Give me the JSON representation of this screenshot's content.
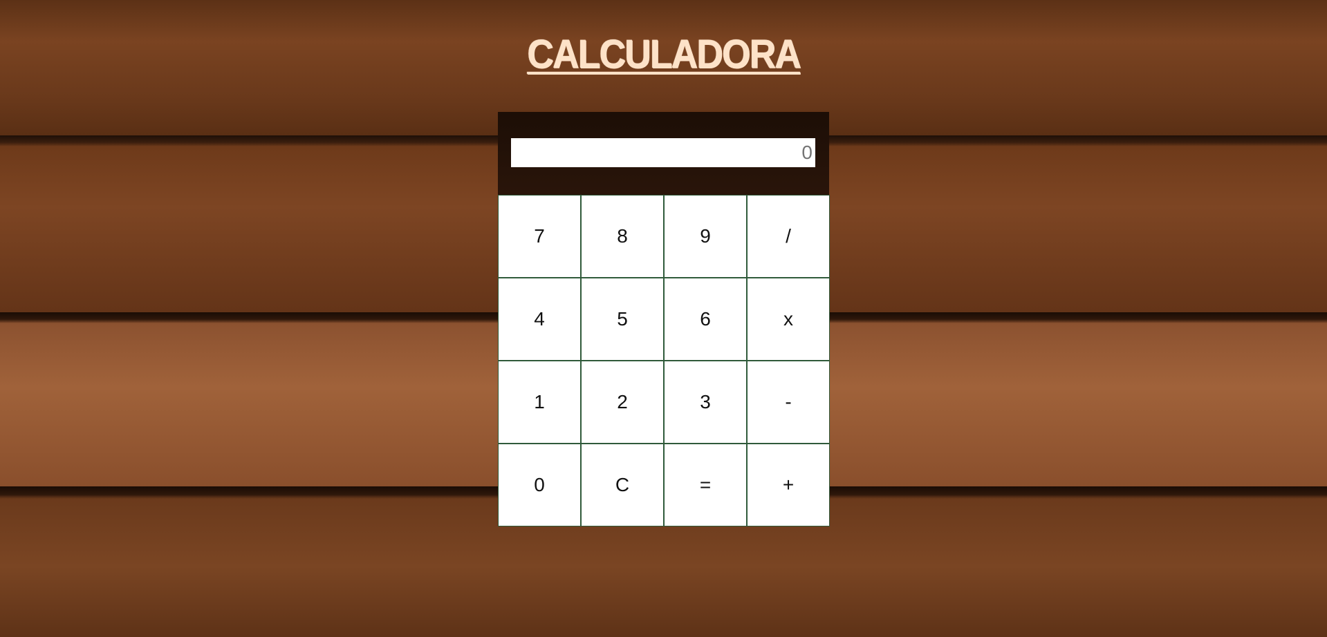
{
  "page": {
    "title": "CALCULADORA"
  },
  "display": {
    "placeholder": "0",
    "value": ""
  },
  "keys": {
    "seven": "7",
    "eight": "8",
    "nine": "9",
    "divide": "/",
    "four": "4",
    "five": "5",
    "six": "6",
    "multiply": "x",
    "one": "1",
    "two": "2",
    "three": "3",
    "subtract": "-",
    "zero": "0",
    "clear": "C",
    "equals": "=",
    "add": "+"
  }
}
